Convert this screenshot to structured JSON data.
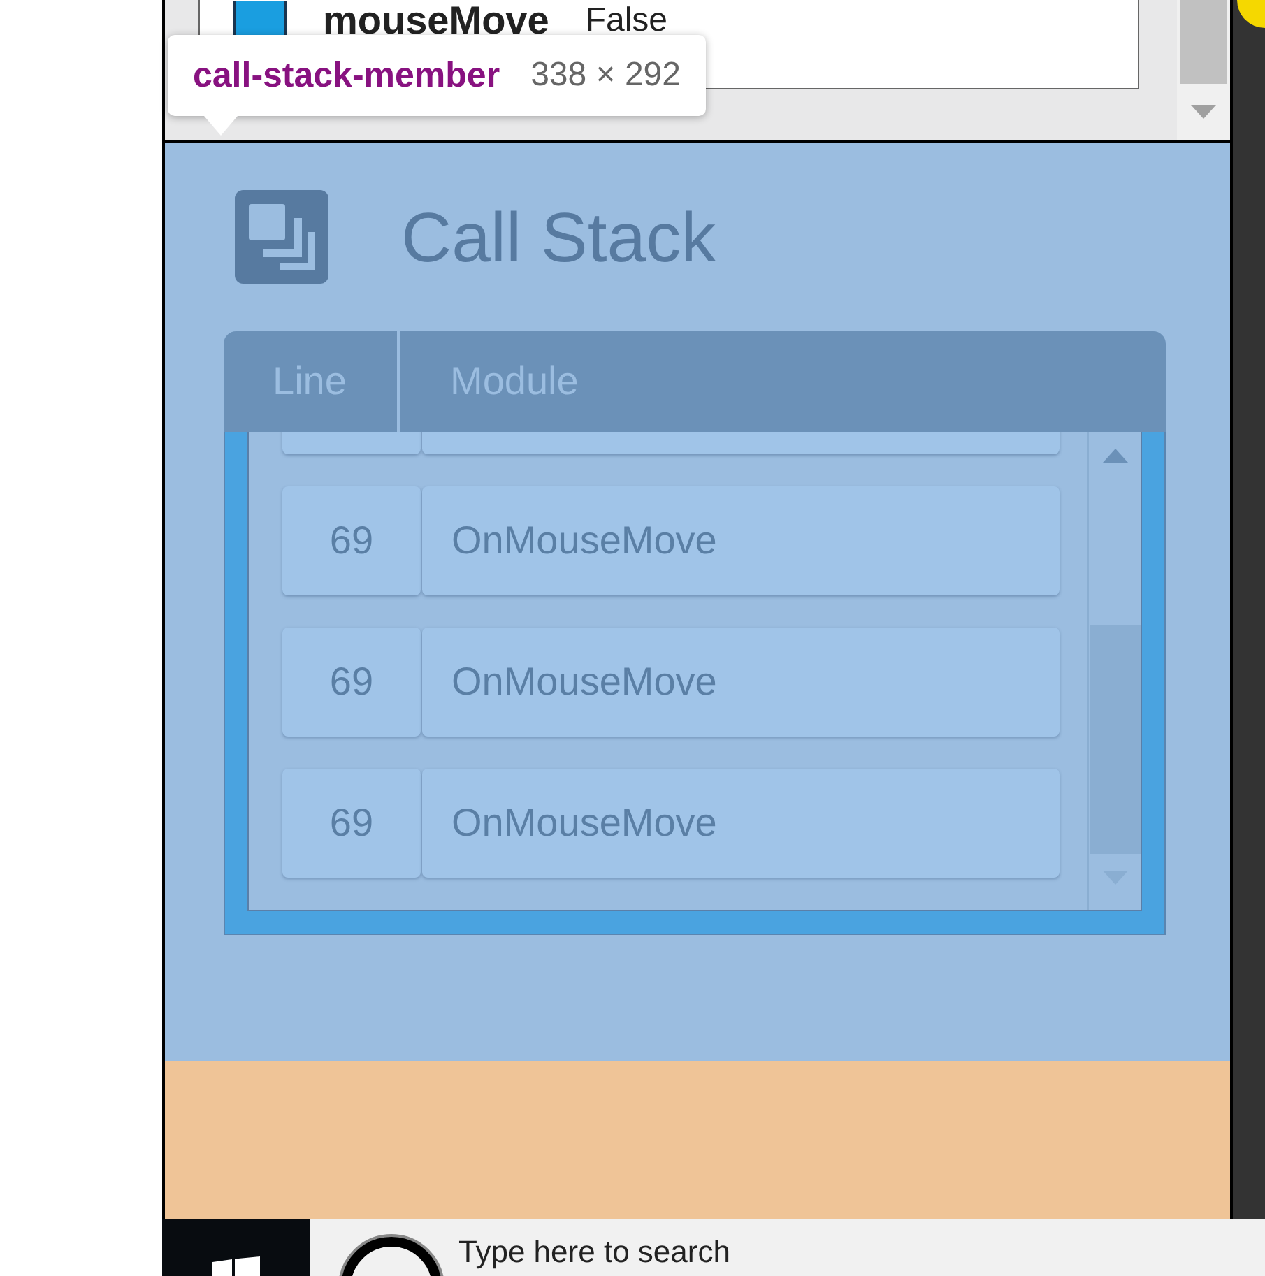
{
  "background_list": {
    "name": "mouseMove",
    "value": "False"
  },
  "tooltip": {
    "name": "call-stack-member",
    "size": "338 × 292"
  },
  "panel": {
    "title": "Call Stack",
    "columns": [
      "Line",
      "Module"
    ],
    "rows": [
      {
        "line": "69",
        "module": "OnMouseMove"
      },
      {
        "line": "69",
        "module": "OnMouseMove"
      },
      {
        "line": "69",
        "module": "OnMouseMove"
      }
    ]
  },
  "taskbar": {
    "search": {
      "placeholder": "Type here to search"
    }
  }
}
